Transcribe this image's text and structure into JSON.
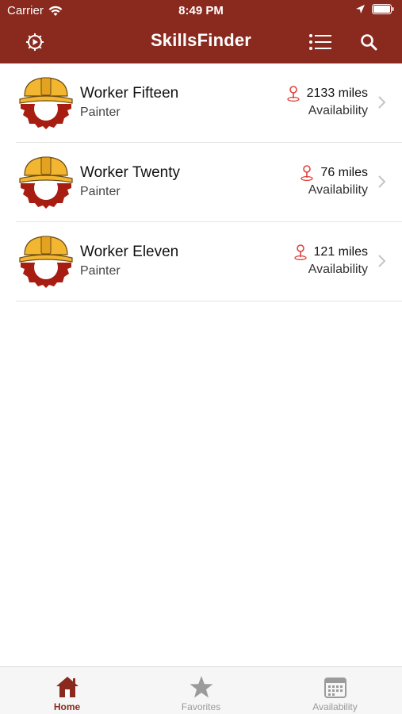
{
  "status_bar": {
    "carrier": "Carrier",
    "time": "8:49 PM"
  },
  "nav": {
    "title": "SkillsFinder"
  },
  "colors": {
    "brand": "#8a2a1f",
    "pin": "#e0413a",
    "helmet": "#f2b631",
    "gear": "#a81d12"
  },
  "workers": [
    {
      "name": "Worker Fifteen",
      "role": "Painter",
      "distance": "2133 miles",
      "availability": "Availability"
    },
    {
      "name": "Worker Twenty",
      "role": "Painter",
      "distance": "76 miles",
      "availability": "Availability"
    },
    {
      "name": "Worker Eleven",
      "role": "Painter",
      "distance": "121 miles",
      "availability": "Availability"
    }
  ],
  "tabs": [
    {
      "label": "Home",
      "icon": "home-icon",
      "active": true
    },
    {
      "label": "Favorites",
      "icon": "star-icon",
      "active": false
    },
    {
      "label": "Availability",
      "icon": "calendar-icon",
      "active": false
    }
  ]
}
